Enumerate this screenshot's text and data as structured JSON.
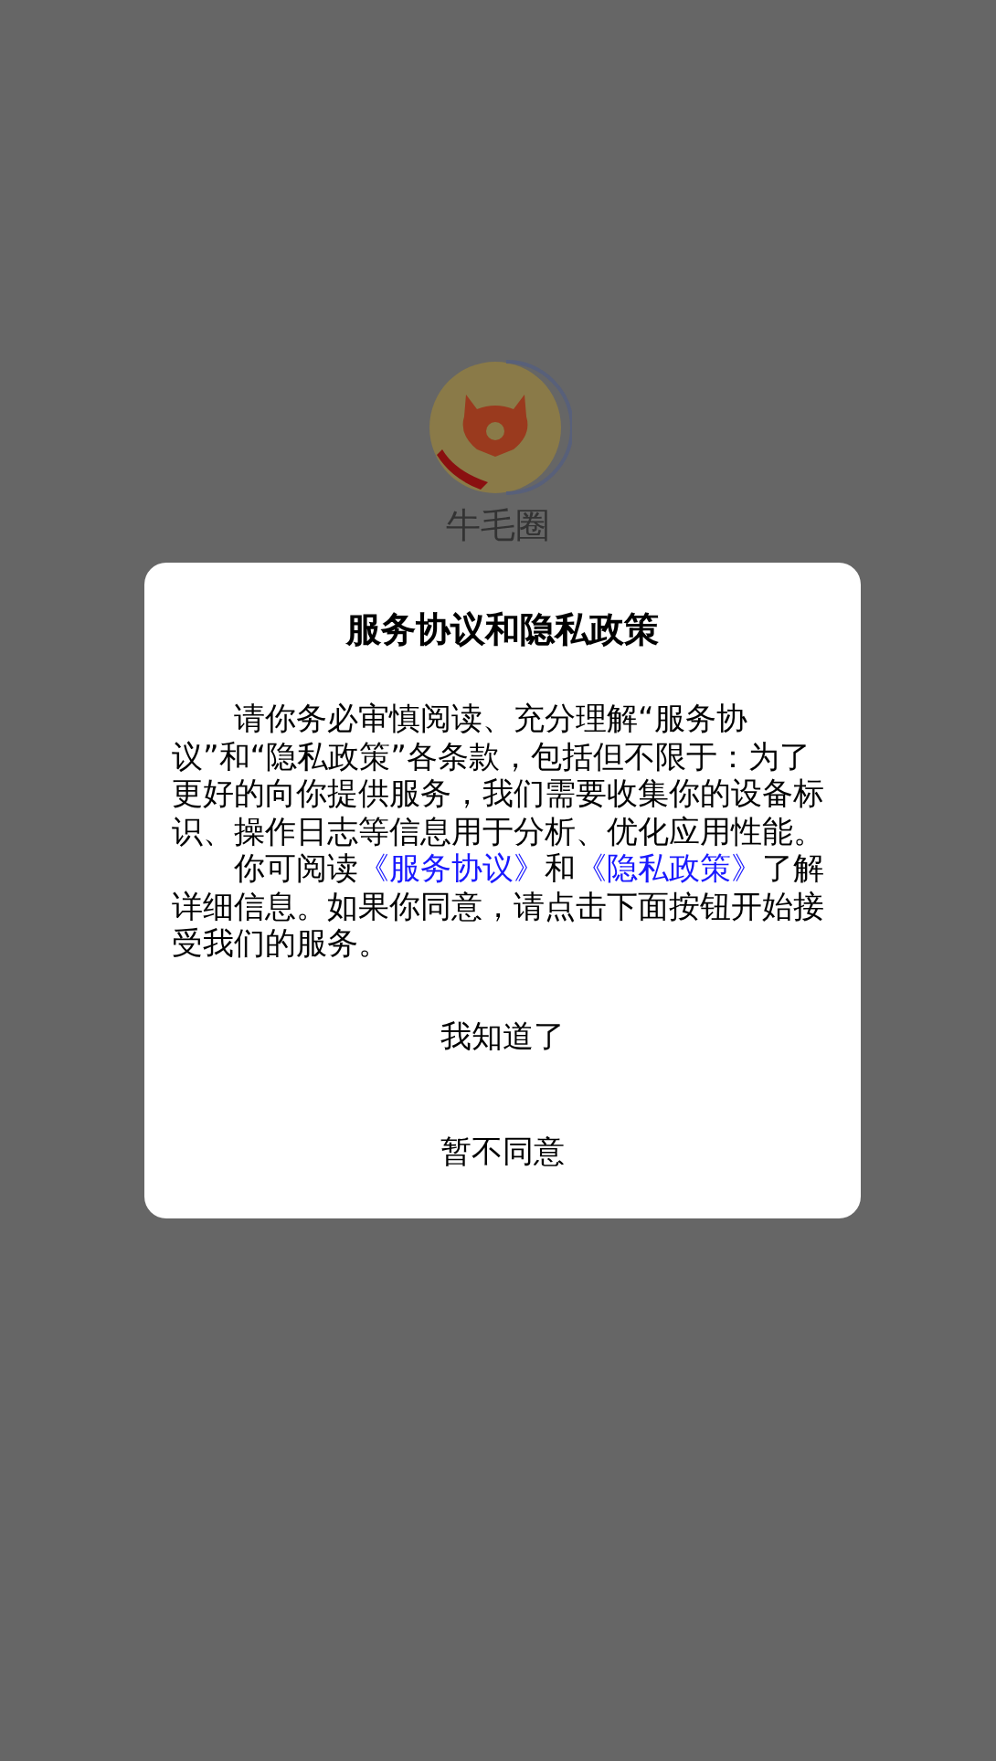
{
  "app": {
    "name": "牛毛圈"
  },
  "dialog": {
    "title": "服务协议和隐私政策",
    "paragraphs": [
      [
        {
          "kind": "text",
          "text": "请你务必审慎阅读、充分理解“服务协议”和“隐私政策”各条款，包括但不限于：为了更好的向你提供服务，我们需要收集你的设备标识、操作日志等信息用于分析、优化应用性能。"
        }
      ],
      [
        {
          "kind": "text",
          "text": "你可阅读"
        },
        {
          "kind": "link",
          "text": "《服务协议》"
        },
        {
          "kind": "text",
          "text": "和"
        },
        {
          "kind": "link",
          "text": "《隐私政策》"
        },
        {
          "kind": "text",
          "text": "了解详细信息。如果你同意，请点击下面按钮开始接受我们的服务。"
        }
      ]
    ],
    "buttons": [
      "我知道了",
      "暂不同意"
    ]
  }
}
